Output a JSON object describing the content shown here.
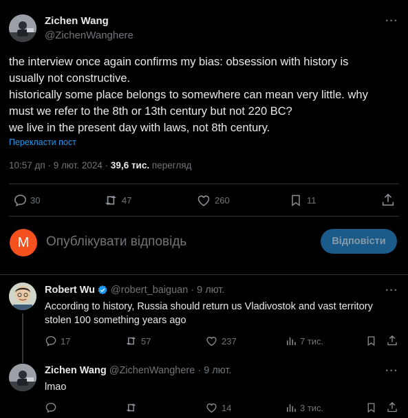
{
  "main_tweet": {
    "author_name": "Zichen Wang",
    "author_handle": "@ZichenWanghere",
    "text_lines": [
      "the interview once again confirms my bias: obsession with history is",
      "usually not constructive.",
      "historically some place belongs to somewhere can mean very little. why",
      "must we refer to the 8th or 13th century but not 220 BC?",
      "we live in the present day with laws, not 8th century."
    ],
    "translate_label": "Перекласти пост",
    "time": "10:57 дп · 9 лют. 2024 ·",
    "views_count": "39,6 тис.",
    "views_label": "перегляд",
    "replies": "30",
    "reposts": "47",
    "likes": "260",
    "bookmarks": "11"
  },
  "reply_box": {
    "avatar_letter": "M",
    "placeholder": "Опублікувати відповідь",
    "button_label": "Відповісти"
  },
  "replies": [
    {
      "author_name": "Robert Wu",
      "author_handle": "@robert_baiguan",
      "date": "· 9 лют.",
      "text_lines": [
        "According to history, Russia should return us Vladivostok and vast territory",
        "stolen 100 something years ago"
      ],
      "replies": "17",
      "reposts": "57",
      "likes": "237",
      "views": "7 тис."
    },
    {
      "author_name": "Zichen Wang",
      "author_handle": "@ZichenWanghere",
      "date": "· 9 лют.",
      "text_lines": [
        "lmao"
      ],
      "replies": "",
      "reposts": "",
      "likes": "14",
      "views": "3 тис."
    }
  ],
  "colors": {
    "background": "#000000",
    "text": "#e7e9ea",
    "muted": "#71767b",
    "accent": "#1d9bf0",
    "reply_button": "#1a5b8a",
    "avatar_m": "#f4511e",
    "divider": "#2f3336"
  }
}
